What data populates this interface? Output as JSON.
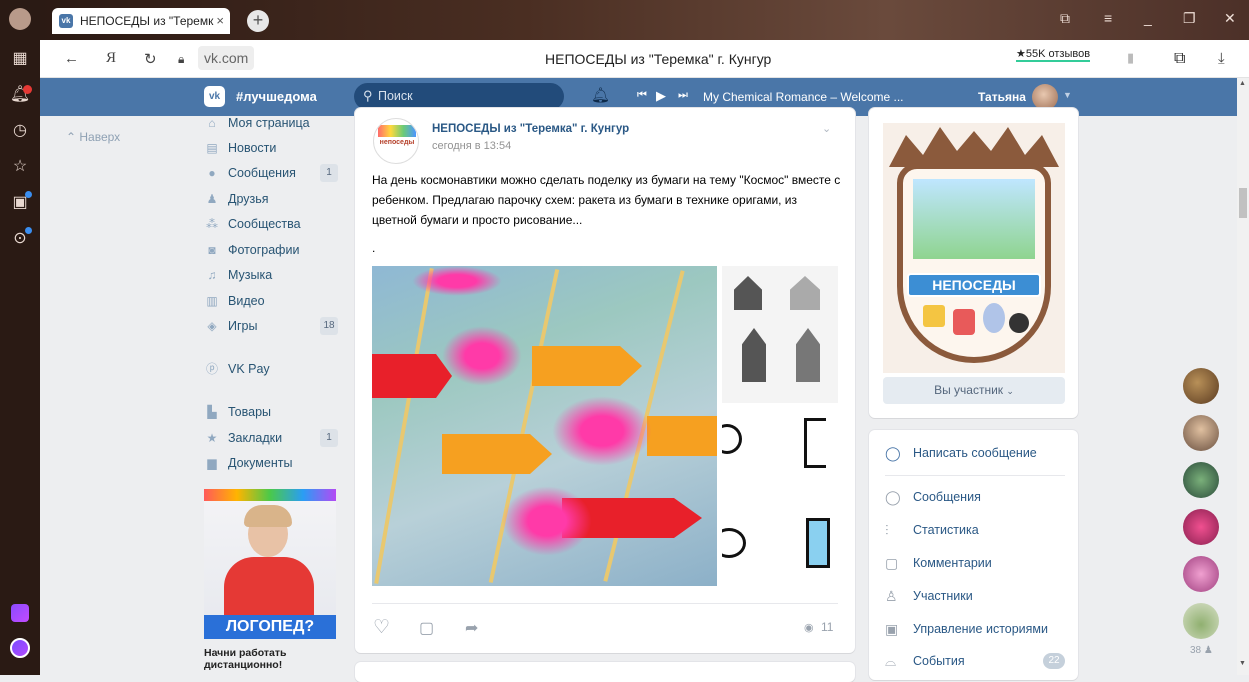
{
  "browser": {
    "tab_title": "НЕПОСЕДЫ из \"Теремк",
    "tab_close": "×",
    "new_tab": "+",
    "favicon": "vk",
    "address": "vk.com",
    "page_title": "НЕПОСЕДЫ из \"Теремка\" г. Кунгур",
    "reviews": "★55K отзывов",
    "yandex_letter": "Я"
  },
  "vk_header": {
    "logo": "vk",
    "hashtag": "#лучшедома",
    "search_placeholder": "Поиск",
    "player_track": "My Chemical Romance – Welcome ...",
    "user_name": "Татьяна"
  },
  "left_nav": {
    "up_label": "Наверх",
    "items": [
      {
        "label": "Моя страница",
        "count": ""
      },
      {
        "label": "Новости",
        "count": ""
      },
      {
        "label": "Сообщения",
        "count": "1"
      },
      {
        "label": "Друзья",
        "count": ""
      },
      {
        "label": "Сообщества",
        "count": ""
      },
      {
        "label": "Фотографии",
        "count": ""
      },
      {
        "label": "Музыка",
        "count": ""
      },
      {
        "label": "Видео",
        "count": ""
      },
      {
        "label": "Игры",
        "count": "18"
      },
      {
        "label": "VK Pay",
        "count": ""
      },
      {
        "label": "Товары",
        "count": ""
      },
      {
        "label": "Закладки",
        "count": "1"
      },
      {
        "label": "Документы",
        "count": ""
      }
    ],
    "ad_banner": "ЛОГОПЕД?",
    "ad_text": "Начни работать дистанционно!"
  },
  "post": {
    "author": "НЕПОСЕДЫ из \"Теремка\" г. Кунгур",
    "time": "сегодня в 13:54",
    "text": "На день космонавтики можно сделать поделку из бумаги на тему \"Космос\" вместе с ребенком. Предлагаю парочку схем: ракета из бумаги в технике оригами, из цветной бумаги и просто рисование...",
    "dot": ".",
    "views": "11",
    "logo_text": "непоседы"
  },
  "group": {
    "badge_text": "НЕПОСЕДЫ",
    "member_button": "Вы участник",
    "write_message": "Написать сообщение",
    "actions": [
      {
        "label": "Сообщения",
        "count": ""
      },
      {
        "label": "Статистика",
        "count": ""
      },
      {
        "label": "Комментарии",
        "count": ""
      },
      {
        "label": "Участники",
        "count": ""
      },
      {
        "label": "Управление историями",
        "count": ""
      },
      {
        "label": "События",
        "count": "22"
      }
    ]
  },
  "friends_online": {
    "count": "38"
  },
  "colors": {
    "vk_blue": "#4a76a8",
    "link": "#2a5885",
    "background": "#edeef0"
  }
}
